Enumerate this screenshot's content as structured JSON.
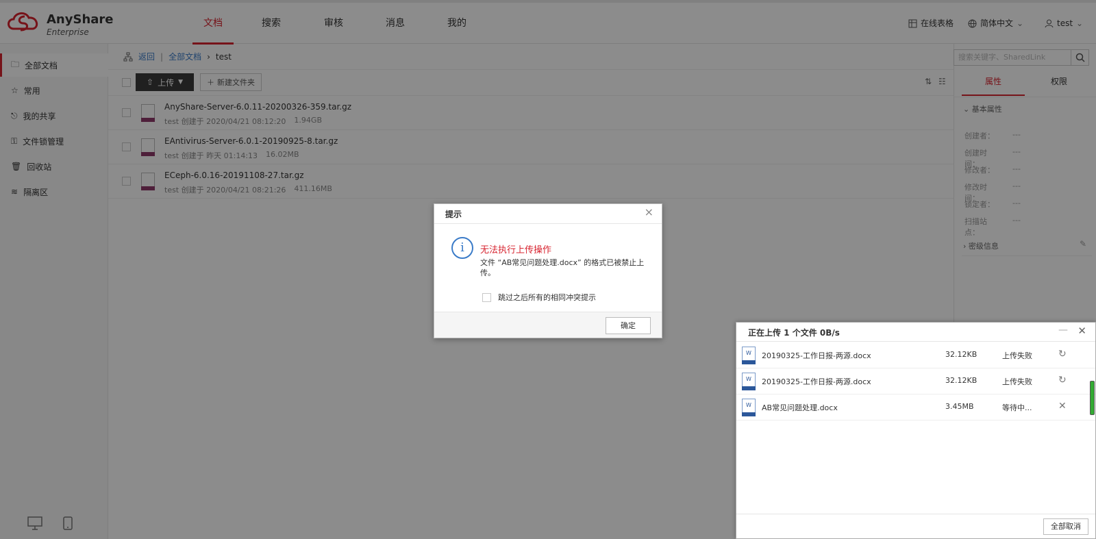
{
  "brand": {
    "name": "AnyShare",
    "edition": "Enterprise"
  },
  "nav": {
    "tabs": [
      "文档",
      "搜索",
      "审核",
      "消息",
      "我的"
    ],
    "active": "文档"
  },
  "header_right": {
    "online_sheet": "在线表格",
    "language": "简体中文",
    "user": "test"
  },
  "sidebar": {
    "items": [
      {
        "label": "全部文档",
        "icon": "folder-icon",
        "active": true
      },
      {
        "label": "常用",
        "icon": "star-icon"
      },
      {
        "label": "我的共享",
        "icon": "share-icon"
      },
      {
        "label": "文件锁管理",
        "icon": "lock-icon"
      },
      {
        "label": "回收站",
        "icon": "trash-icon"
      },
      {
        "label": "隔离区",
        "icon": "layers-icon"
      }
    ]
  },
  "breadcrumb": {
    "back": "返回",
    "root": "全部文档",
    "current": "test"
  },
  "toolbar": {
    "upload": "上传",
    "new_folder": "新建文件夹"
  },
  "files": [
    {
      "name": "AnyShare-Server-6.0.11-20200326-359.tar.gz",
      "meta": "test 创建于 2020/04/21 08:12:20",
      "size": "1.94GB"
    },
    {
      "name": "EAntivirus-Server-6.0.1-20190925-8.tar.gz",
      "meta": "test 创建于 昨天 01:14:13",
      "size": "16.02MB"
    },
    {
      "name": "ECeph-6.0.16-20191108-27.tar.gz",
      "meta": "test 创建于 2020/04/21 08:21:26",
      "size": "411.16MB"
    }
  ],
  "right_panel": {
    "search_placeholder": "搜索关键字、SharedLink",
    "tabs": [
      "属性",
      "权限"
    ],
    "basic_section": "基本属性",
    "props": [
      {
        "label": "创建者：",
        "value": "---"
      },
      {
        "label": "创建时间：",
        "value": "---"
      },
      {
        "label": "修改者：",
        "value": "---"
      },
      {
        "label": "修改时间：",
        "value": "---"
      },
      {
        "label": "锁定者：",
        "value": "---"
      },
      {
        "label": "扫描站点：",
        "value": "---"
      }
    ],
    "secret_section": "密级信息"
  },
  "dialog": {
    "title": "提示",
    "heading": "无法执行上传操作",
    "message": "文件 “AB常见问题处理.docx” 的格式已被禁止上传。",
    "checkbox_label": "跳过之后所有的相同冲突提示",
    "ok": "确定"
  },
  "upload_panel": {
    "title": "正在上传 1 个文件 0B/s",
    "rows": [
      {
        "name": "20190325-工作日报-两源.docx",
        "size": "32.12KB",
        "status": "上传失败",
        "action": "retry"
      },
      {
        "name": "20190325-工作日报-两源.docx",
        "size": "32.12KB",
        "status": "上传失败",
        "action": "retry"
      },
      {
        "name": "AB常见问题处理.docx",
        "size": "3.45MB",
        "status": "等待中...",
        "action": "cancel"
      }
    ],
    "cancel_all": "全部取消"
  },
  "colors": {
    "accent": "#d7232f",
    "link": "#3a7bc8"
  }
}
